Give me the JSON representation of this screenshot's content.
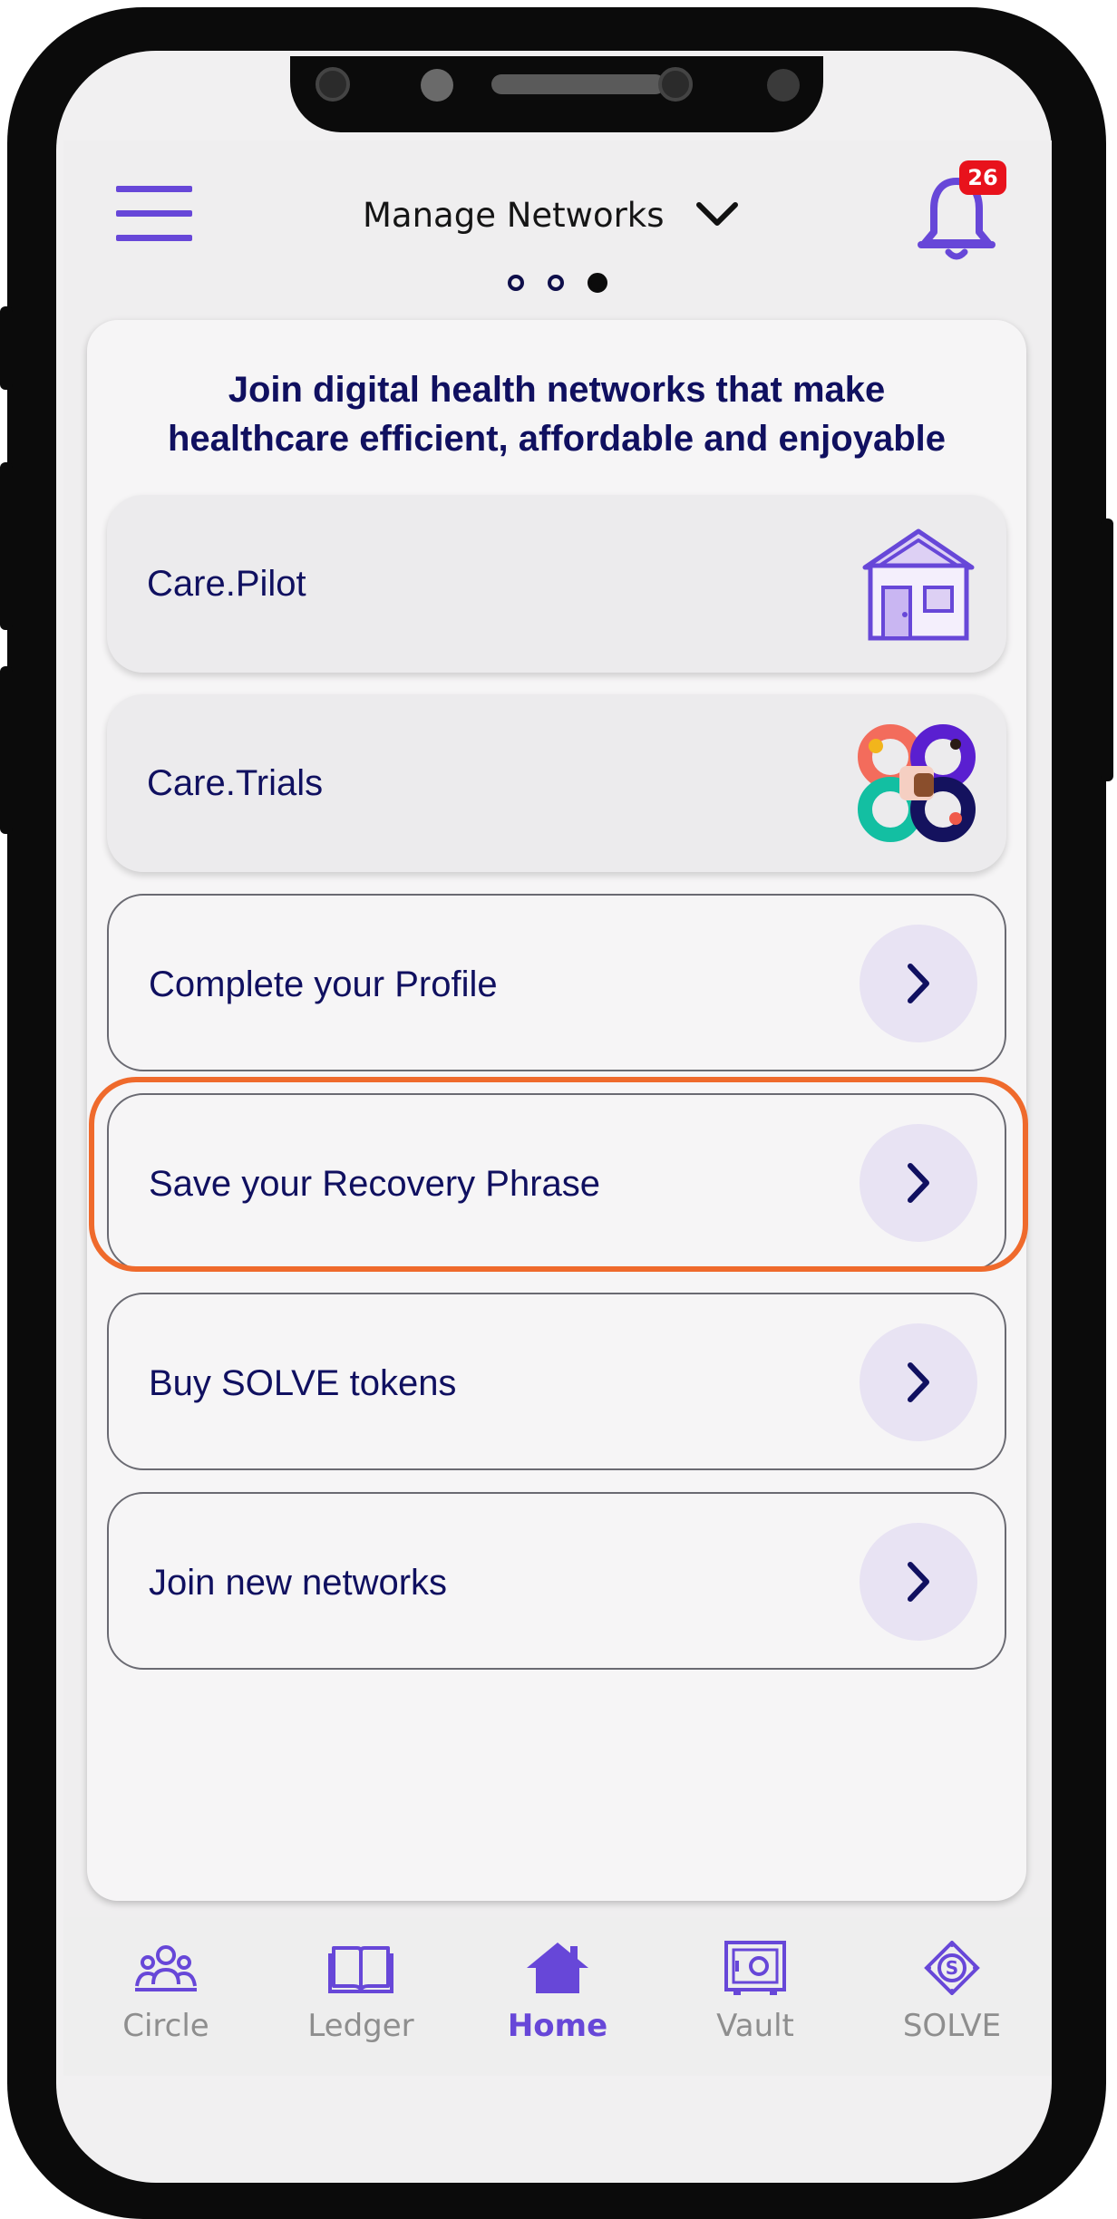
{
  "header": {
    "title": "Manage Networks",
    "notification_count": "26"
  },
  "pager": {
    "total": 3,
    "active": 3
  },
  "main": {
    "headline_line1": "Join digital health networks that make",
    "headline_line2": "healthcare efficient, affordable and enjoyable",
    "networks": [
      {
        "label": "Care.Pilot",
        "icon": "house-icon"
      },
      {
        "label": "Care.Trials",
        "icon": "care-trials-logo"
      }
    ],
    "actions": [
      {
        "label": "Complete your Profile"
      },
      {
        "label": "Save your Recovery Phrase",
        "highlighted": true
      },
      {
        "label": "Buy SOLVE tokens"
      },
      {
        "label": "Join new networks"
      }
    ]
  },
  "bottom_nav": {
    "items": [
      {
        "label": "Circle",
        "icon": "circle-people-icon"
      },
      {
        "label": "Ledger",
        "icon": "book-icon"
      },
      {
        "label": "Home",
        "icon": "home-icon",
        "active": true
      },
      {
        "label": "Vault",
        "icon": "safe-icon"
      },
      {
        "label": "SOLVE",
        "icon": "solve-token-icon"
      }
    ]
  },
  "colors": {
    "accent": "#6747d8",
    "navy_text": "#101060",
    "highlight": "#ef6a2c",
    "badge": "#e8121c"
  }
}
